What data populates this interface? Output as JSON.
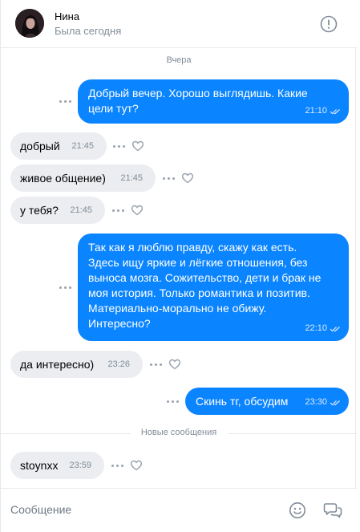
{
  "header": {
    "name": "Нина",
    "status": "Была сегодня"
  },
  "chat": {
    "date_separator": "Вчера",
    "new_messages_separator": "Новые сообщения",
    "messages": [
      {
        "direction": "out",
        "text": "Добрый вечер. Хорошо выглядишь. Какие\nцели тут?",
        "time": "21:10"
      },
      {
        "direction": "in",
        "text": "добрый",
        "time": "21:45"
      },
      {
        "direction": "in",
        "text": "живое общение)",
        "time": "21:45"
      },
      {
        "direction": "in",
        "text": "у тебя?",
        "time": "21:45"
      },
      {
        "direction": "out",
        "text": "Так как я люблю правду, скажу как есть.\nЗдесь ищу яркие и лёгкие отношения, без\nвыноса мозга. Сожительство, дети и брак не\nмоя история. Только романтика и позитив.\nМатериально-морально не обижу.\nИнтересно?",
        "time": "22:10"
      },
      {
        "direction": "in",
        "text": "да интересно)",
        "time": "23:26"
      },
      {
        "direction": "out",
        "text": "Скинь тг, обсудим",
        "time": "23:30"
      },
      {
        "direction": "in",
        "text": "stoynxx",
        "time": "23:59"
      }
    ]
  },
  "composer": {
    "placeholder": "Сообщение"
  },
  "colors": {
    "outgoing_bubble": "#0a84ff",
    "incoming_bubble": "#ebedf0",
    "secondary_text": "#818c99"
  },
  "icons": {
    "info": "info-icon",
    "more": "more-dots-icon",
    "like": "heart-icon",
    "read": "double-check-icon",
    "emoji": "smile-icon",
    "send": "chats-icon"
  }
}
